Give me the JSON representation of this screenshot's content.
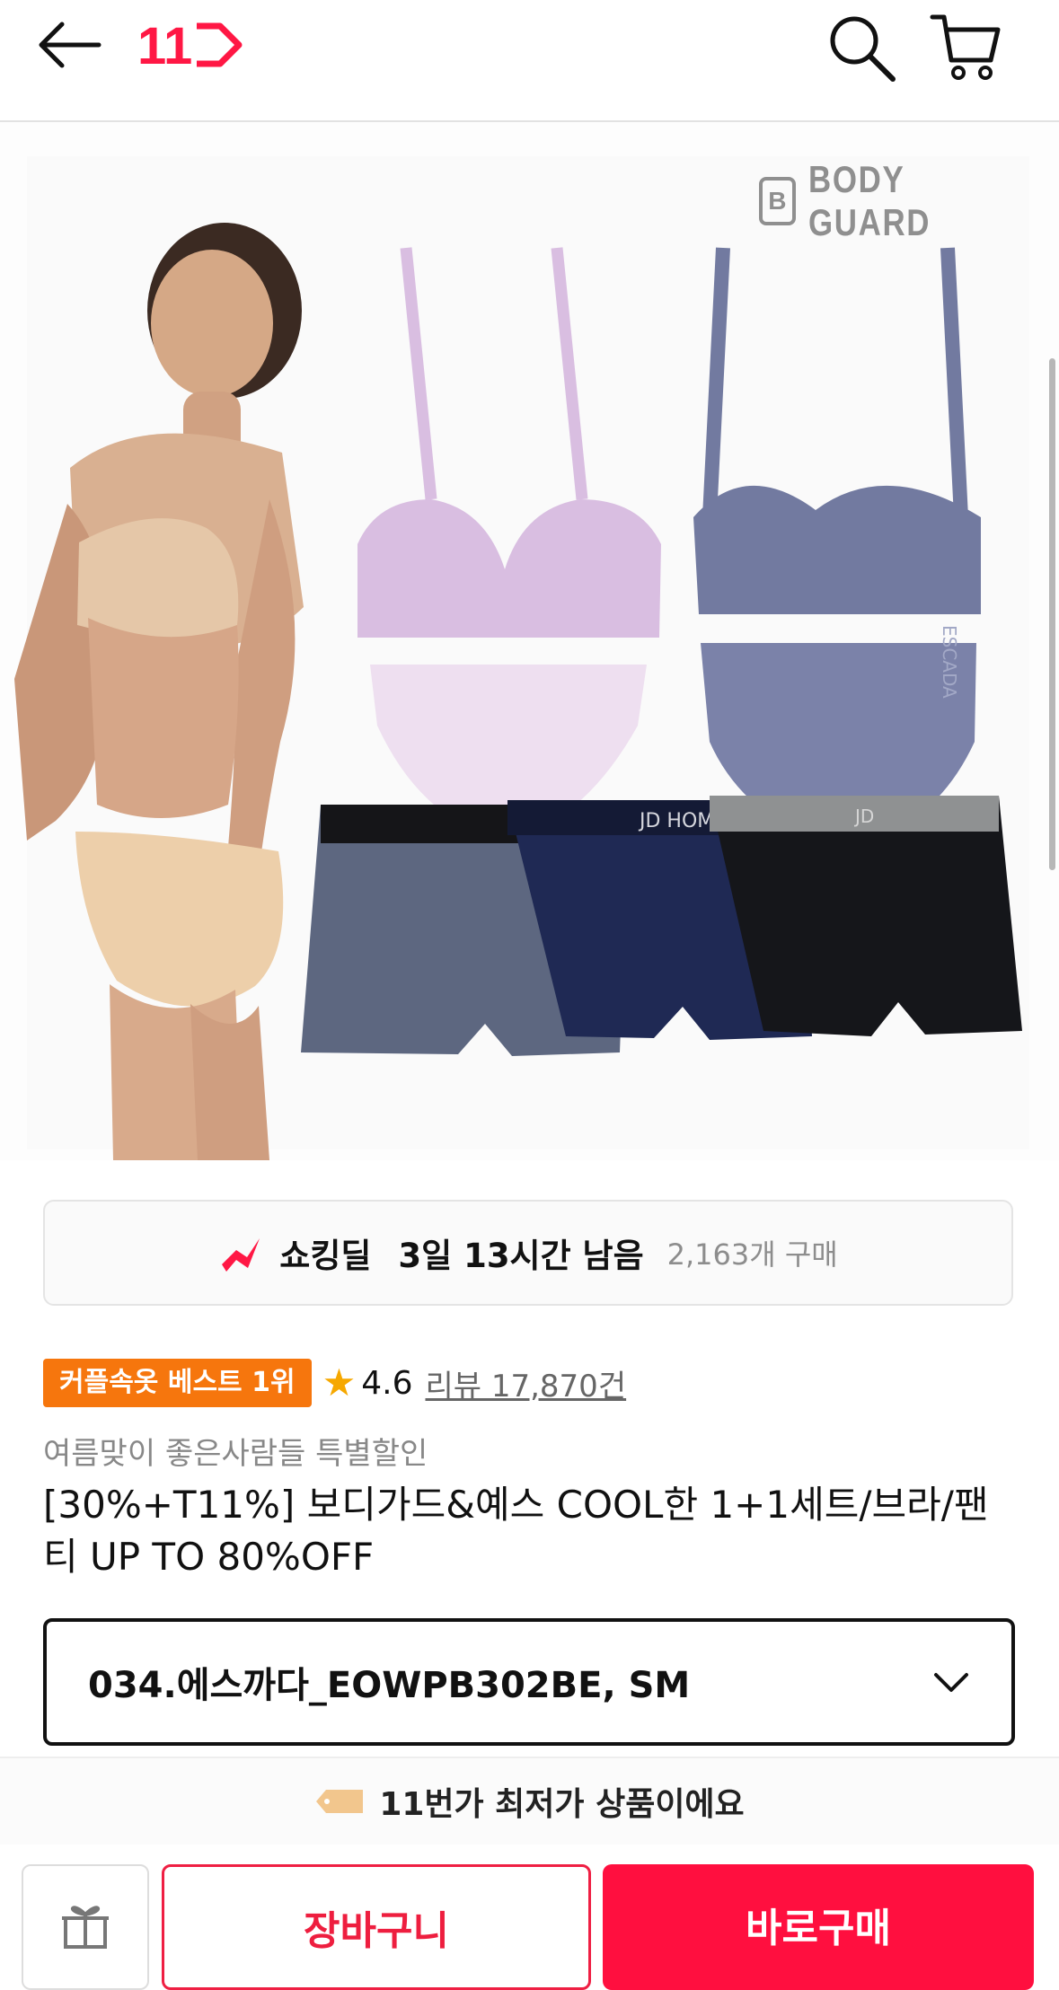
{
  "header": {
    "back_icon": "back-arrow-icon",
    "logo_text": "11",
    "search_icon": "search-icon",
    "cart_icon": "cart-icon"
  },
  "hero": {
    "brand_mark": "B",
    "brand_text": "BODY GUARD",
    "product_labels": [
      "ESCADA",
      "JD HOMME",
      "JD"
    ]
  },
  "deal": {
    "name": "쇼킹딜",
    "time_left": "3일 13시간 남음",
    "purchase_count": "2,163개 구매"
  },
  "badges": {
    "best": "커플속옷 베스트 1위",
    "rating": "4.6",
    "review": "리뷰 17,870건"
  },
  "product": {
    "promo": "여름맞이 좋은사람들 특별할인",
    "title": "[30%+T11%] 보디가드&예스 COOL한 1+1세트/브라/팬티 UP TO 80%OFF"
  },
  "option": {
    "selected": "034.에스까다_EOWPB302BE, SM"
  },
  "price_note": {
    "text": "11번가 최저가 상품이에요"
  },
  "actions": {
    "cart": "장바구니",
    "buy": "바로구매"
  },
  "colors": {
    "brand": "#ff1744",
    "badge": "#f6760d",
    "primary": "#ff0f3f"
  }
}
